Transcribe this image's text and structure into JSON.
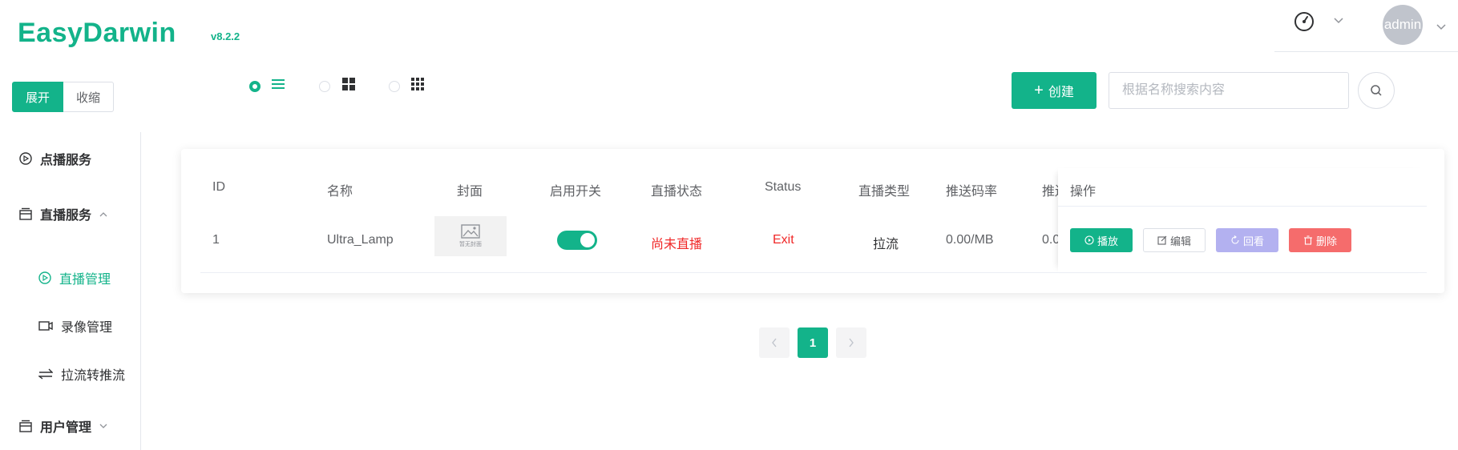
{
  "app": {
    "name": "EasyDarwin",
    "version": "v8.2.2"
  },
  "header": {
    "user": "admin"
  },
  "toolbar": {
    "expand_label": "展开",
    "collapse_label": "收缩",
    "create_label": "创建",
    "search_placeholder": "根据名称搜索内容",
    "view_mode_selected": "list"
  },
  "sidebar": {
    "items": [
      {
        "label": "点播服务",
        "icon": "play-circle-icon"
      },
      {
        "label": "直播服务",
        "icon": "folder-icon",
        "expanded": true
      },
      {
        "label": "直播管理",
        "icon": "play-circle-icon",
        "active": true
      },
      {
        "label": "录像管理",
        "icon": "video-camera-icon"
      },
      {
        "label": "拉流转推流",
        "icon": "switch-arrows-icon"
      },
      {
        "label": "用户管理",
        "icon": "folder-icon",
        "expanded": false
      }
    ]
  },
  "table": {
    "columns": [
      "ID",
      "名称",
      "封面",
      "启用开关",
      "直播状态",
      "Status",
      "直播类型",
      "推送码率",
      "推送",
      "操作"
    ],
    "rows": [
      {
        "id": "1",
        "name": "Ultra_Lamp",
        "cover_text": "暂无封面",
        "enabled": true,
        "live_status": "尚未直播",
        "status": "Exit",
        "type": "拉流",
        "bitrate": "0.00/MB",
        "push_partial": "0.0"
      }
    ],
    "actions": {
      "play": "播放",
      "edit": "编辑",
      "playback": "回看",
      "delete": "删除"
    }
  },
  "pagination": {
    "current": "1"
  },
  "colors": {
    "primary": "#13b38a",
    "danger": "#f56c6c",
    "disabled": "#b3b1f0",
    "status_red": "#f02828"
  }
}
